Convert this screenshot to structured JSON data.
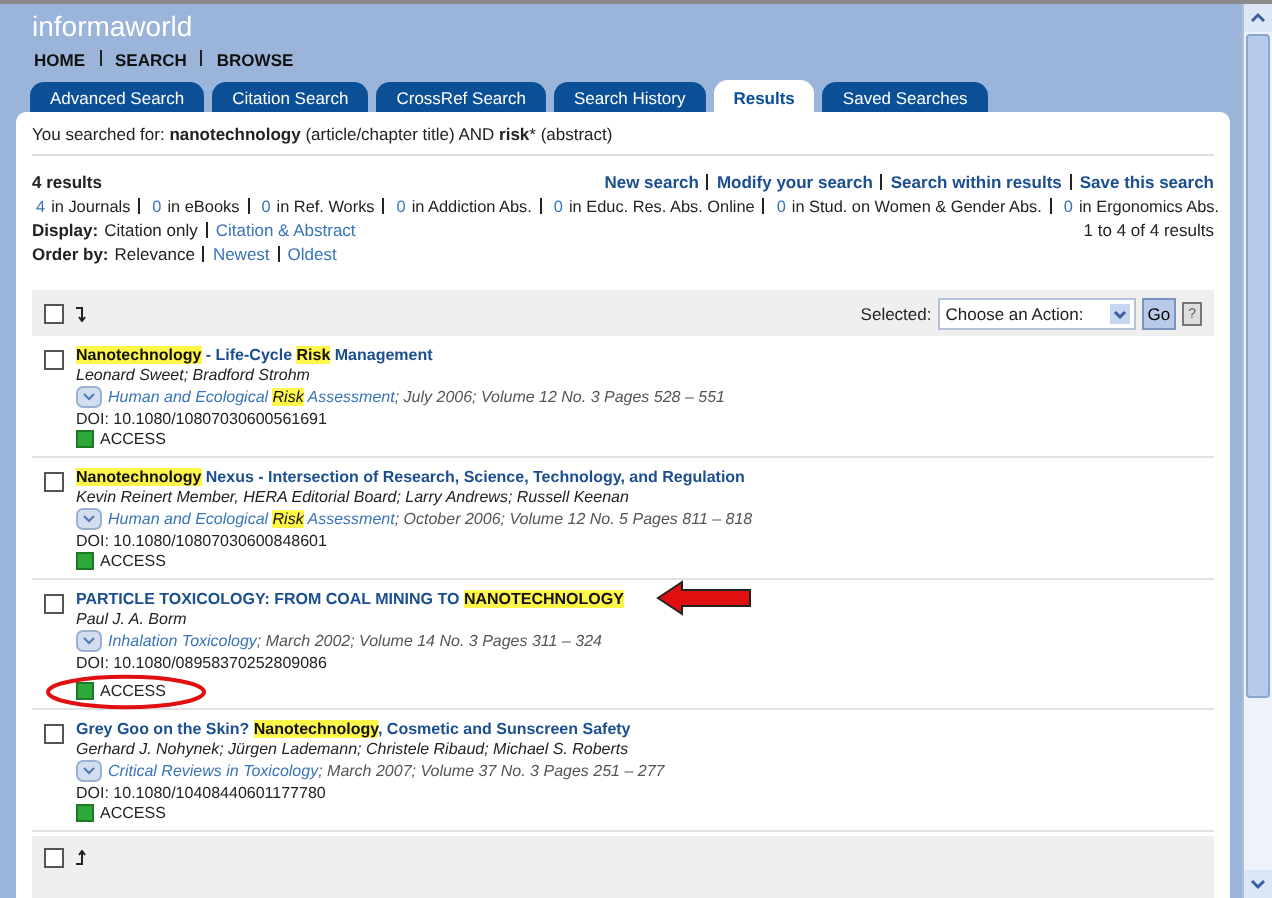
{
  "logo": "informaworld",
  "nav": [
    "HOME",
    "SEARCH",
    "BROWSE"
  ],
  "tabs": [
    {
      "label": "Advanced Search",
      "selected": false
    },
    {
      "label": "Citation Search",
      "selected": false
    },
    {
      "label": "CrossRef Search",
      "selected": false
    },
    {
      "label": "Search History",
      "selected": false
    },
    {
      "label": "Results",
      "selected": true
    },
    {
      "label": "Saved Searches",
      "selected": false
    }
  ],
  "query": "You searched for: **nanotechnology** (article/chapter title) AND **risk*** (abstract)",
  "result_count": "4 results",
  "actions": [
    "New search",
    "Modify your search",
    "Search within results",
    "Save this search"
  ],
  "sources": [
    {
      "count": "4",
      "label": "in Journals"
    },
    {
      "count": "0",
      "label": "in eBooks"
    },
    {
      "count": "0",
      "label": "in Ref. Works"
    },
    {
      "count": "0",
      "label": "in Addiction Abs."
    },
    {
      "count": "0",
      "label": "in Educ. Res. Abs. Online"
    },
    {
      "count": "0",
      "label": "in Stud. on Women & Gender Abs."
    },
    {
      "count": "0",
      "label": "in Ergonomics Abs."
    }
  ],
  "display": {
    "label": "Display:",
    "options": [
      {
        "label": "Citation only",
        "selected": true
      },
      {
        "label": "Citation & Abstract",
        "selected": false
      }
    ]
  },
  "range": "1 to 4 of 4 results",
  "order": {
    "label": "Order by:",
    "options": [
      {
        "label": "Relevance",
        "selected": true
      },
      {
        "label": "Newest",
        "selected": false
      },
      {
        "label": "Oldest",
        "selected": false
      }
    ]
  },
  "toolbar": {
    "selected_label": "Selected:",
    "action": "Choose an Action:",
    "go": "Go",
    "help": "?"
  },
  "results": [
    {
      "checked": false,
      "title": [
        {
          "text": "Nanotechnology",
          "highlight": true
        },
        {
          "text": " - Life-Cycle ",
          "highlight": false
        },
        {
          "text": "Risk",
          "highlight": true
        },
        {
          "text": " Management",
          "highlight": false
        }
      ],
      "authors": "Leonard Sweet; Bradford Strohm",
      "journal": [
        {
          "text": "Human and Ecological ",
          "highlight": false
        },
        {
          "text": "Risk",
          "highlight": true
        },
        {
          "text": " Assessment",
          "highlight": false
        }
      ],
      "details": "; July 2006; Volume 12 No. 3 Pages 528 – 551",
      "doi": "DOI: 10.1080/10807030600561691",
      "access": "ACCESS",
      "annotated": false
    },
    {
      "checked": false,
      "title": [
        {
          "text": "Nanotechnology",
          "highlight": true
        },
        {
          "text": " Nexus - Intersection of Research, Science, Technology, and Regulation",
          "highlight": false
        }
      ],
      "authors": "Kevin Reinert Member, HERA Editorial Board;  Larry Andrews; Russell Keenan",
      "journal": [
        {
          "text": "Human and Ecological ",
          "highlight": false
        },
        {
          "text": "Risk",
          "highlight": true
        },
        {
          "text": " Assessment",
          "highlight": false
        }
      ],
      "details": "; October 2006; Volume 12 No. 5 Pages 811 – 818",
      "doi": "DOI: 10.1080/10807030600848601",
      "access": "ACCESS",
      "annotated": false
    },
    {
      "checked": false,
      "title": [
        {
          "text": "PARTICLE TOXICOLOGY: FROM COAL MINING TO ",
          "highlight": false
        },
        {
          "text": "NANOTECHNOLOGY",
          "highlight": true
        }
      ],
      "authors": "Paul J. A. Borm",
      "journal": [
        {
          "text": "Inhalation Toxicology",
          "highlight": false
        }
      ],
      "details": "; March 2002; Volume 14 No. 3 Pages 311 – 324",
      "doi": "DOI: 10.1080/08958370252809086",
      "access": "ACCESS",
      "annotated": true
    },
    {
      "checked": false,
      "title": [
        {
          "text": "Grey Goo on the Skin? ",
          "highlight": false
        },
        {
          "text": "Nanotechnology",
          "highlight": true
        },
        {
          "text": ", Cosmetic and Sunscreen Safety",
          "highlight": false
        }
      ],
      "authors": "Gerhard J. Nohynek;  Jürgen Lademann;  Christele Ribaud; Michael S. Roberts",
      "journal": [
        {
          "text": "Critical Reviews in Toxicology",
          "highlight": false
        }
      ],
      "details": "; March 2007; Volume 37 No. 3 Pages 251 – 277",
      "doi": "DOI: 10.1080/10408440601177780",
      "access": "ACCESS",
      "annotated": false
    }
  ],
  "bottom_checkbox": {
    "checked": false
  }
}
